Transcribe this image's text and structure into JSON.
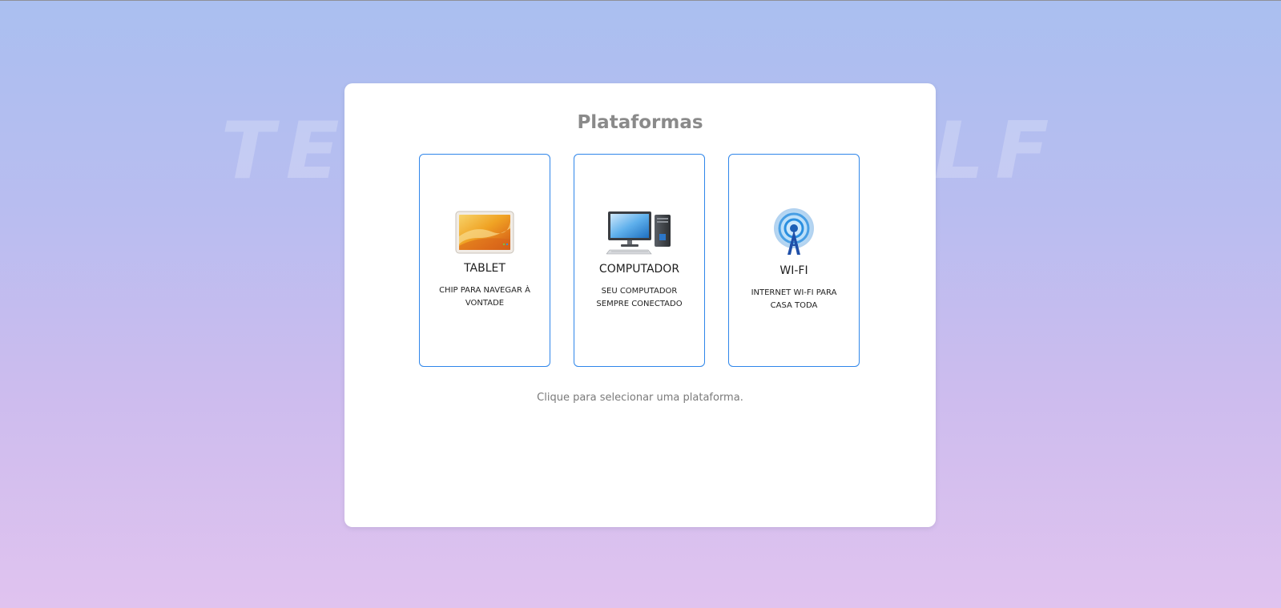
{
  "background_watermark": "TELL YOURSELF",
  "page": {
    "title": "Plataformas",
    "hint": "Clique para selecionar uma plataforma."
  },
  "platforms": [
    {
      "label": "TABLET",
      "description": "CHIP PARA NAVEGAR À VONTADE",
      "icon": "tablet-icon"
    },
    {
      "label": "COMPUTADOR",
      "description": "SEU COMPUTADOR SEMPRE CONECTADO",
      "icon": "desktop-computer-icon"
    },
    {
      "label": "WI-FI",
      "description": "INTERNET WI-FI PARA CASA TODA",
      "icon": "wifi-tower-icon"
    }
  ],
  "colors": {
    "card_border": "#2f86ea",
    "title": "#8a8a8a",
    "background_top": "#aabff0",
    "background_bottom": "#e0c3ef"
  }
}
